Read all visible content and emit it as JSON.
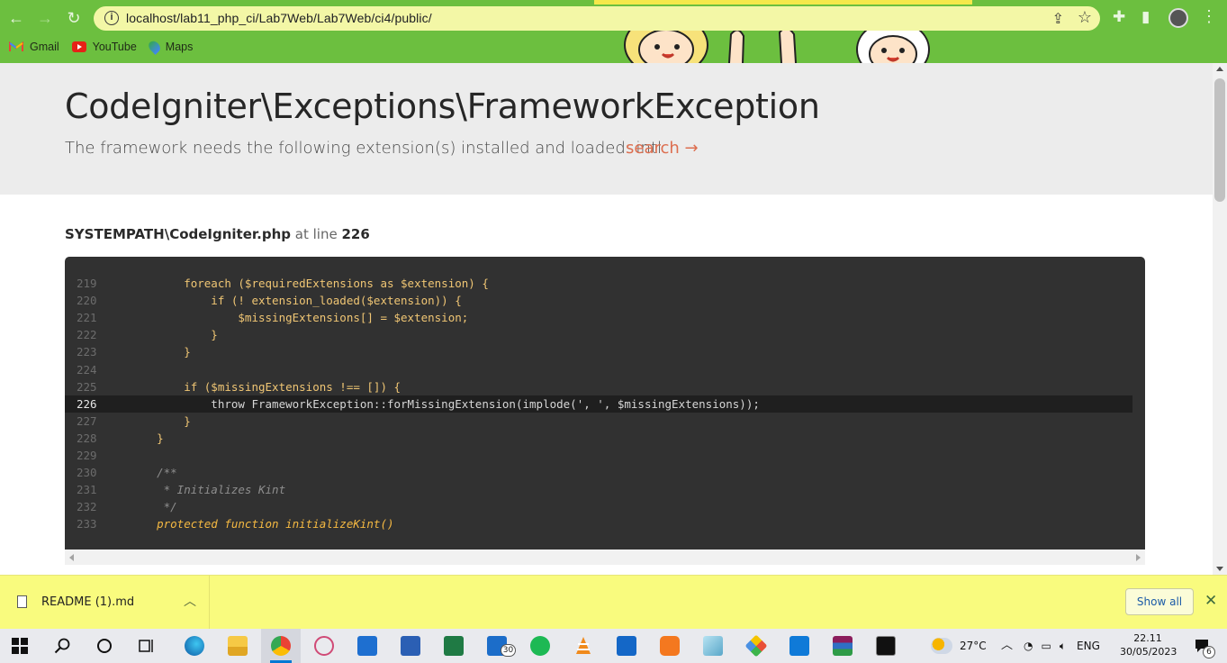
{
  "browser": {
    "url": "localhost/lab11_php_ci/Lab7Web/Lab7Web/ci4/public/",
    "bookmarks": [
      {
        "label": "Gmail",
        "icon": "gmail-icon"
      },
      {
        "label": "YouTube",
        "icon": "youtube-icon"
      },
      {
        "label": "Maps",
        "icon": "maps-icon"
      }
    ],
    "theme_color": "#6cbf3f"
  },
  "error": {
    "title": "CodeIgniter\\Exceptions\\FrameworkException",
    "message": "The framework needs the following extension(s) installed and loaded: intl.",
    "search_label": "search →",
    "file": "SYSTEMPATH\\CodeIgniter.php",
    "at_line_text": "at line",
    "line": "226"
  },
  "code_lines": [
    {
      "num": "219",
      "text": "        foreach ($requiredExtensions as $extension) {",
      "style": "code"
    },
    {
      "num": "220",
      "text": "            if (! extension_loaded($extension)) {",
      "style": "code"
    },
    {
      "num": "221",
      "text": "                $missingExtensions[] = $extension;",
      "style": "code"
    },
    {
      "num": "222",
      "text": "            }",
      "style": "code"
    },
    {
      "num": "223",
      "text": "        }",
      "style": "code"
    },
    {
      "num": "224",
      "text": "",
      "style": "code"
    },
    {
      "num": "225",
      "text": "        if ($missingExtensions !== []) {",
      "style": "code"
    },
    {
      "num": "226",
      "text": "            throw FrameworkException::forMissingExtension(implode(', ', $missingExtensions));",
      "style": "highlight"
    },
    {
      "num": "227",
      "text": "        }",
      "style": "code"
    },
    {
      "num": "228",
      "text": "    }",
      "style": "code"
    },
    {
      "num": "229",
      "text": "",
      "style": "code"
    },
    {
      "num": "230",
      "text": "    /**",
      "style": "comment"
    },
    {
      "num": "231",
      "text": "     * Initializes Kint",
      "style": "comment"
    },
    {
      "num": "232",
      "text": "     */",
      "style": "comment"
    },
    {
      "num": "233",
      "text": "    protected function initializeKint()",
      "style": "keyword"
    }
  ],
  "download_bar": {
    "file_name": "README (1).md",
    "show_all_label": "Show all"
  },
  "taskbar": {
    "apps": [
      "start-icon",
      "search-icon",
      "cortana-icon",
      "task-view-icon",
      "edge-icon",
      "file-explorer-icon",
      "chrome-icon",
      "snipping-icon",
      "store-icon",
      "word-icon",
      "excel-icon",
      "mail-icon",
      "spotify-icon",
      "vlc-icon",
      "media-player-icon",
      "xampp-icon",
      "notepad-icon",
      "git-icon",
      "vscode-icon",
      "winrar-icon",
      "terminal-icon"
    ],
    "mail_badge": "30",
    "weather": "27°C",
    "language": "ENG",
    "time": "22.11",
    "date": "30/05/2023",
    "notification_count": "6"
  }
}
